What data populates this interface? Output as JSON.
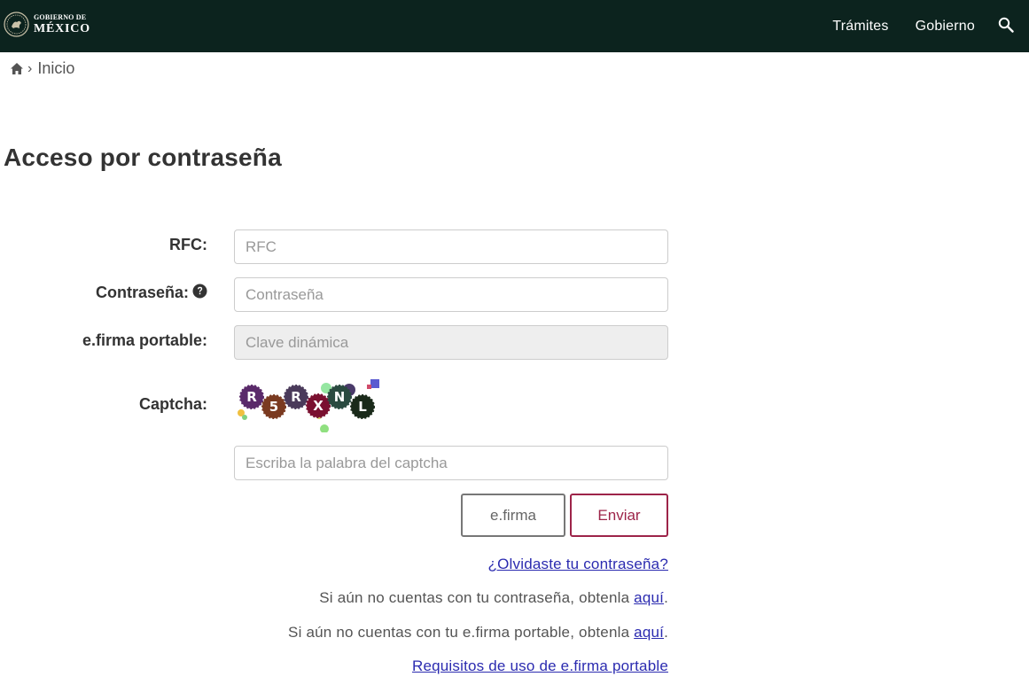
{
  "header": {
    "logo": {
      "line1": "GOBIERNO DE",
      "line2": "MÉXICO"
    },
    "nav": [
      {
        "label": "Trámites"
      },
      {
        "label": "Gobierno"
      }
    ],
    "search_icon": "search-icon",
    "background_color": "#0c231e"
  },
  "breadcrumb": {
    "home_icon": "home-icon",
    "current": "Inicio"
  },
  "page": {
    "title": "Acceso por contraseña"
  },
  "form": {
    "rfc": {
      "label": "RFC:",
      "placeholder": "RFC",
      "value": ""
    },
    "password": {
      "label": "Contraseña:",
      "placeholder": "Contraseña",
      "value": "",
      "help_icon": "question-circle-icon"
    },
    "efirma_portable": {
      "label": "e.firma portable:",
      "placeholder": "Clave dinámica",
      "value": ""
    },
    "captcha": {
      "label": "Captcha:",
      "characters": [
        "R",
        "5",
        "R",
        "X",
        "N",
        "L"
      ],
      "placeholder": "Escriba la palabra del captcha",
      "value": ""
    },
    "buttons": {
      "efirma": "e.firma",
      "enviar": "Enviar"
    },
    "accent_color": "#9d2449"
  },
  "links": {
    "forgot_password": "¿Olvidaste tu contraseña?",
    "no_password": {
      "text": "Si aún no cuentas con tu contraseña, obtenla ",
      "link": "aquí",
      "suffix": "."
    },
    "no_efirma": {
      "text": "Si aún no cuentas con tu e.firma portable, obtenla ",
      "link": "aquí",
      "suffix": "."
    },
    "requirements": "Requisitos de uso de e.firma portable"
  }
}
